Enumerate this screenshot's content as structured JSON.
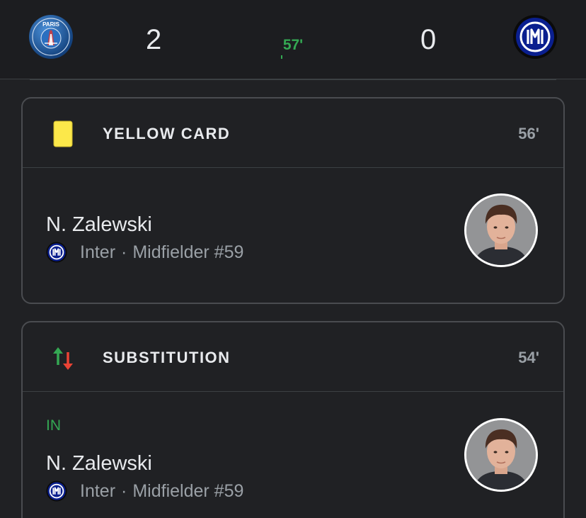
{
  "match": {
    "home_team": "PSG",
    "home_score": "2",
    "away_team": "Inter",
    "away_score": "0",
    "minute": "57'",
    "live_color": "#34a853",
    "home_crest_text": "PARIS"
  },
  "events": [
    {
      "type": "yellow-card",
      "title": "YELLOW CARD",
      "minute": "56'",
      "icon": "yellow-card-icon",
      "player": {
        "name": "N. Zalewski",
        "team": "Inter",
        "separator": "·",
        "role": "Midfielder #59"
      }
    },
    {
      "type": "substitution",
      "title": "SUBSTITUTION",
      "minute": "54'",
      "icon": "substitution-arrows-icon",
      "in_label": "IN",
      "player": {
        "name": "N. Zalewski",
        "team": "Inter",
        "separator": "·",
        "role": "Midfielder #59"
      }
    }
  ],
  "colors": {
    "background": "#202124",
    "card_border": "#4a4c50",
    "yellow_card": "#fce84a",
    "sub_in": "#34a853",
    "sub_out": "#ea4335",
    "inter_blue": "#0a1f8f",
    "psg_blue": "#1d63b0"
  }
}
